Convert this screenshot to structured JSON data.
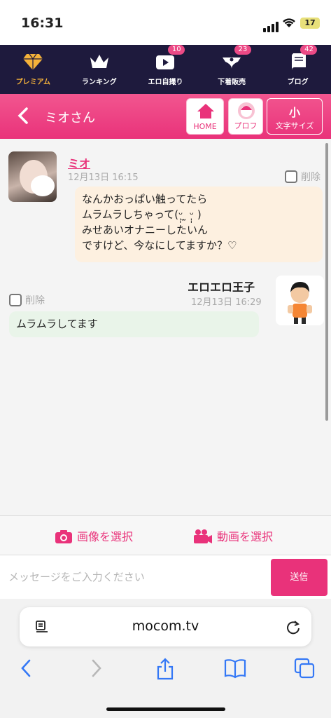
{
  "status": {
    "time": "16:31",
    "battery": "17"
  },
  "nav": [
    {
      "label": "プレミアム",
      "icon": "diamond-icon",
      "badge": ""
    },
    {
      "label": "ランキング",
      "icon": "crown-icon",
      "badge": ""
    },
    {
      "label": "エロ自撮り",
      "icon": "play-icon",
      "badge": "10"
    },
    {
      "label": "下着販売",
      "icon": "underwear-icon",
      "badge": "23"
    },
    {
      "label": "ブログ",
      "icon": "book-icon",
      "badge": "42"
    }
  ],
  "header": {
    "title": "ミオさん",
    "home_label": "HOME",
    "prof_label": "プロフ",
    "size_big": "小",
    "size_label": "文字サイズ"
  },
  "messages": [
    {
      "sender": "ミオ",
      "time": "12月13日 16:15",
      "delete_label": "削除",
      "text": "なんかおっぱい触ってたら\nムラムラしちゃって(ᵕ̩̩ ̫ ᵕ̩̩ )\nみせあいオナニーしたいん\nですけど、今なにしてますか？♡"
    },
    {
      "sender": "エロエロ王子",
      "time": "12月13日 16:29",
      "delete_label": "削除",
      "text": "ムラムラしてます"
    }
  ],
  "media": {
    "image_label": "画像を選択",
    "video_label": "動画を選択"
  },
  "input": {
    "placeholder": "メッセージをご入力ください",
    "send_label": "送信"
  },
  "browser": {
    "domain": "mocom.tv"
  },
  "colors": {
    "accent": "#e9327a",
    "nav_bg": "#1e1a3d",
    "premium": "#f5b23a"
  }
}
